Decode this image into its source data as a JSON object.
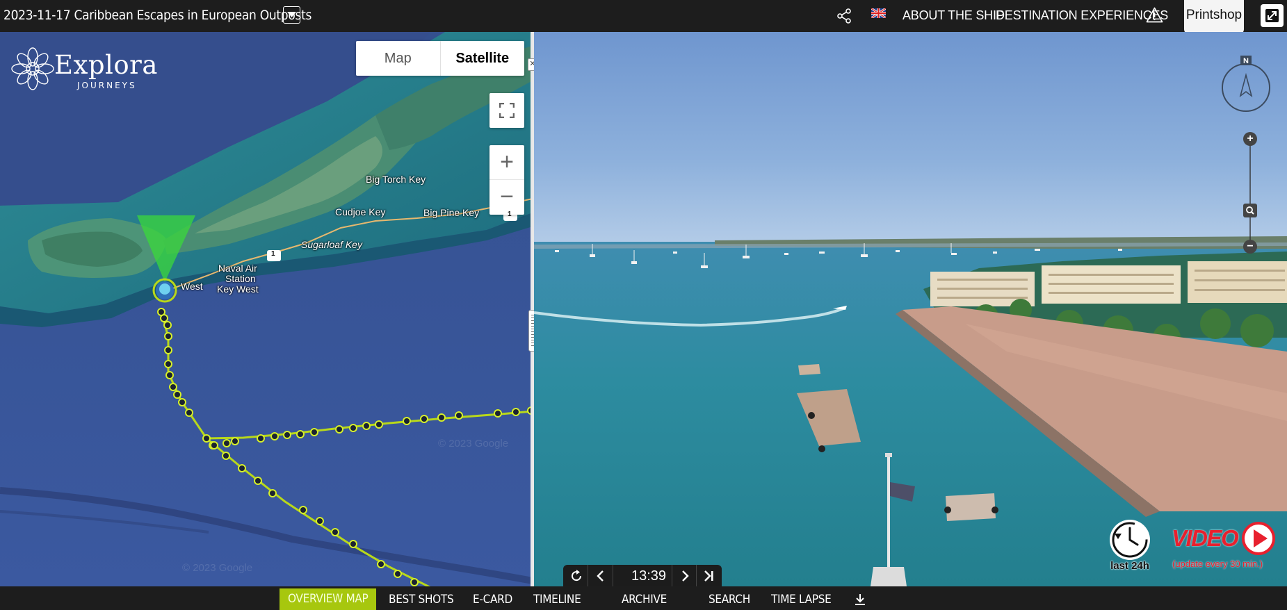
{
  "header": {
    "title": "2023-11-17 Caribbean Escapes in European Outposts",
    "nav": [
      "ABOUT THE SHIP",
      "DESTINATION EXPERIENCES"
    ],
    "printshop": "Printshop",
    "icons": [
      "share-icon",
      "uk-flag-icon",
      "warning-icon",
      "expand-icon",
      "chevron-down-icon"
    ]
  },
  "map": {
    "logo": {
      "name": "Explora",
      "tagline": "JOURNEYS"
    },
    "map_type": {
      "map": "Map",
      "satellite": "Satellite",
      "selected": "Satellite"
    },
    "places": {
      "big_torch_key": "Big Torch Key",
      "cudjoe_key": "Cudjoe Key",
      "big_pine_key": "Big Pine Key",
      "sugarloaf_key": "Sugarloaf Key",
      "naval_air": "Naval Air",
      "station": "Station",
      "key_west_1": "Key West",
      "key_west_2": "West",
      "route_1": "1",
      "route_1b": "1"
    },
    "watermarks": [
      "© 2023 Google",
      "© 2023 Google"
    ],
    "zoom": {
      "in": "+",
      "out": "−"
    }
  },
  "camera": {
    "compass": "N",
    "zoom": {
      "in": "+",
      "out": "−"
    },
    "last24": "last 24h",
    "video": "VIDEO",
    "video_note": "(update every 30 min.)",
    "time": "13:39",
    "colors": {
      "video_red": "#e8202e",
      "accent_green": "#a7c70e"
    }
  },
  "bottom_nav": {
    "items": [
      "OVERVIEW MAP",
      "BEST SHOTS",
      "E-CARD",
      "TIMELINE",
      "ARCHIVE",
      "SEARCH",
      "TIME LAPSE"
    ],
    "active": "OVERVIEW MAP"
  }
}
